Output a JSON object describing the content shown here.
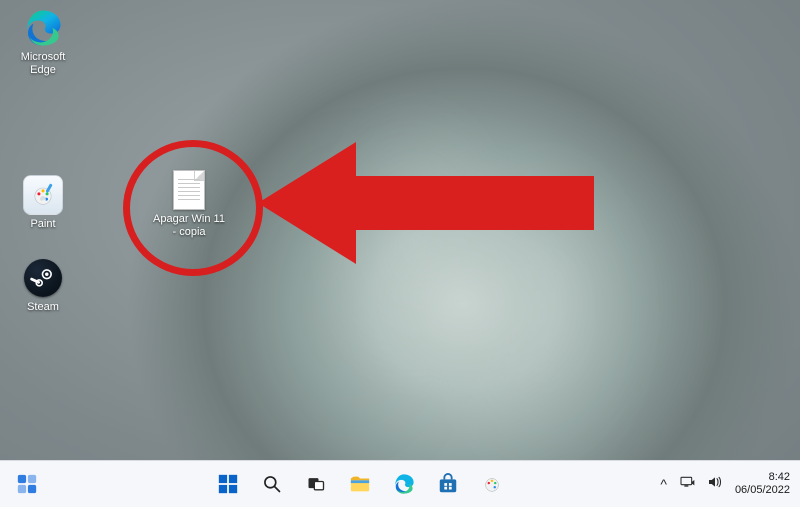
{
  "desktop": {
    "icons": {
      "edge": {
        "label": "Microsoft Edge"
      },
      "paint": {
        "label": "Paint"
      },
      "steam": {
        "label": "Steam"
      },
      "txt": {
        "label": "Apagar Win 11 - copia"
      }
    }
  },
  "taskbar": {
    "system_tray": {
      "chevron": "^",
      "network": "network-icon",
      "volume": "volume-icon"
    },
    "clock": {
      "time": "8:42",
      "date": "06/05/2022"
    }
  }
}
